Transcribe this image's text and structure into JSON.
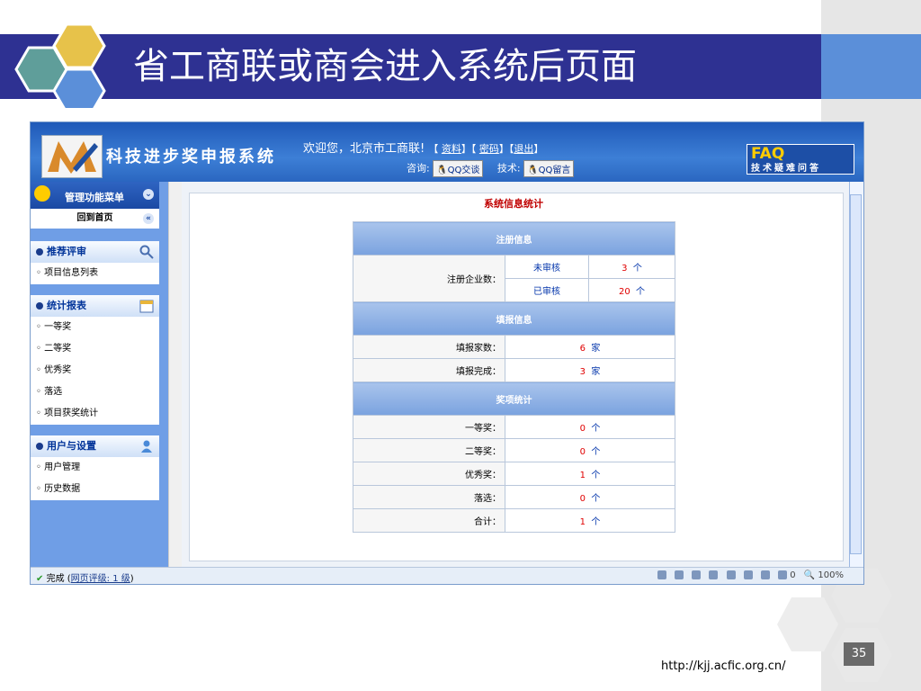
{
  "slide": {
    "title": "省工商联或商会进入系统后页面",
    "url": "http://kjj.acfic.org.cn/",
    "page_number": "35"
  },
  "colors": {
    "title_band": "#2e3192",
    "title_band_right": "#5b8fd9",
    "hex_gold": "#e7c24a",
    "hex_teal": "#5f9e9a",
    "hex_blue": "#5b8fd9",
    "hex_grey": "#e8e8e8"
  },
  "app": {
    "system_name": "科技进步奖申报系统",
    "welcome": "欢迎您，北京市工商联!",
    "links": {
      "profile": "资料",
      "password": "密码",
      "logout": "退出"
    },
    "consult_label": "咨询:",
    "qq_chat": "QQ交谈",
    "tech_label": "技术:",
    "qq_message": "QQ留言",
    "faq_big": "FAQ",
    "faq_small": "技术疑难问答"
  },
  "sidebar": {
    "header": "管理功能菜单",
    "home": "回到首页",
    "groups": [
      {
        "title": "推荐评审",
        "icon": "magnifier-icon",
        "items": [
          "项目信息列表"
        ]
      },
      {
        "title": "统计报表",
        "icon": "calendar-icon",
        "items": [
          "一等奖",
          "二等奖",
          "优秀奖",
          "落选",
          "项目获奖统计"
        ]
      },
      {
        "title": "用户与设置",
        "icon": "user-icon",
        "items": [
          "用户管理",
          "历史数据"
        ]
      }
    ]
  },
  "stats": {
    "title": "系统信息统计",
    "registration": {
      "header": "注册信息",
      "label": "注册企业数：",
      "rows": [
        {
          "status": "未审核",
          "value": "3",
          "unit": "个"
        },
        {
          "status": "已审核",
          "value": "20",
          "unit": "个"
        }
      ]
    },
    "filing": {
      "header": "填报信息",
      "rows": [
        {
          "label": "填报家数：",
          "value": "6",
          "unit": "家"
        },
        {
          "label": "填报完成：",
          "value": "3",
          "unit": "家"
        }
      ]
    },
    "awards": {
      "header": "奖项统计",
      "rows": [
        {
          "label": "一等奖：",
          "value": "0",
          "unit": "个"
        },
        {
          "label": "二等奖：",
          "value": "0",
          "unit": "个"
        },
        {
          "label": "优秀奖：",
          "value": "1",
          "unit": "个"
        },
        {
          "label": "落选：",
          "value": "0",
          "unit": "个"
        },
        {
          "label": "合计：",
          "value": "1",
          "unit": "个"
        }
      ]
    }
  },
  "statusbar": {
    "done": "完成",
    "rating_link": "网页评级: 1 级",
    "count": "0",
    "zoom": "100%"
  }
}
